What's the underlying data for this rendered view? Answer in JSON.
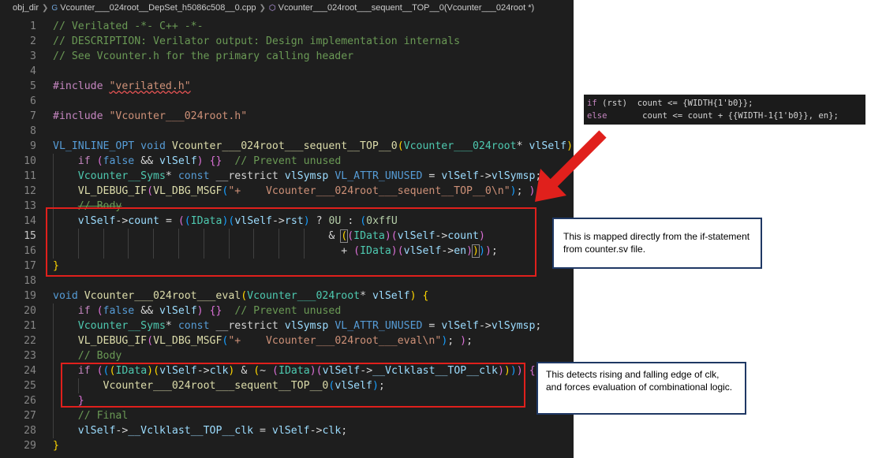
{
  "breadcrumb": {
    "folder": "obj_dir",
    "file": "Vcounter___024root__DepSet_h5086c508__0.cpp",
    "symbol": "Vcounter___024root___sequent__TOP__0(Vcounter___024root *)"
  },
  "colors": {
    "comment": "#6a9955",
    "keyword": "#569cd6",
    "string": "#ce9178",
    "function": "#dcdcaa",
    "type": "#4ec9b0",
    "variable": "#9cdcfe",
    "number": "#b5cea8",
    "highlight_box": "#e0201c",
    "callout_border": "#1f3864"
  },
  "active_line": 15,
  "lines": [
    {
      "n": "1",
      "tokens": [
        {
          "t": "// Verilated -*- C++ -*-",
          "c": "cm"
        }
      ]
    },
    {
      "n": "2",
      "tokens": [
        {
          "t": "// DESCRIPTION: Verilator output: Design implementation internals",
          "c": "cm"
        }
      ]
    },
    {
      "n": "3",
      "tokens": [
        {
          "t": "// See Vcounter.h for the primary calling header",
          "c": "cm"
        }
      ]
    },
    {
      "n": "4",
      "tokens": []
    },
    {
      "n": "5",
      "tokens": [
        {
          "t": "#include ",
          "c": "pp"
        },
        {
          "t": "\"verilated.h\"",
          "c": "str squig"
        }
      ]
    },
    {
      "n": "6",
      "tokens": []
    },
    {
      "n": "7",
      "tokens": [
        {
          "t": "#include ",
          "c": "pp"
        },
        {
          "t": "\"Vcounter___024root.h\"",
          "c": "str"
        }
      ]
    },
    {
      "n": "8",
      "tokens": []
    },
    {
      "n": "9",
      "tokens": [
        {
          "t": "VL_INLINE_OPT ",
          "c": "mc"
        },
        {
          "t": "void ",
          "c": "kw"
        },
        {
          "t": "Vcounter___024root___sequent__TOP__0",
          "c": "fn"
        },
        {
          "t": "(",
          "c": "br1"
        },
        {
          "t": "Vcounter___024root",
          "c": "ty"
        },
        {
          "t": "* "
        },
        {
          "t": "vlSelf",
          "c": "var"
        },
        {
          "t": ")",
          "c": "br1"
        },
        {
          "t": " "
        },
        {
          "t": "{",
          "c": "br1"
        }
      ]
    },
    {
      "n": "10",
      "guides": [
        1
      ],
      "tokens": [
        {
          "t": "    "
        },
        {
          "t": "if ",
          "c": "pp"
        },
        {
          "t": "(",
          "c": "br2"
        },
        {
          "t": "false ",
          "c": "kw"
        },
        {
          "t": "&& "
        },
        {
          "t": "vlSelf",
          "c": "var"
        },
        {
          "t": ")",
          "c": "br2"
        },
        {
          "t": " "
        },
        {
          "t": "{}",
          "c": "br2"
        },
        {
          "t": "  "
        },
        {
          "t": "// Prevent unused",
          "c": "cm"
        }
      ]
    },
    {
      "n": "11",
      "guides": [
        1
      ],
      "tokens": [
        {
          "t": "    "
        },
        {
          "t": "Vcounter__Syms",
          "c": "ty"
        },
        {
          "t": "* "
        },
        {
          "t": "const ",
          "c": "kw"
        },
        {
          "t": "__restrict "
        },
        {
          "t": "vlSymsp ",
          "c": "var"
        },
        {
          "t": "VL_ATTR_UNUSED ",
          "c": "mc"
        },
        {
          "t": "= "
        },
        {
          "t": "vlSelf",
          "c": "var"
        },
        {
          "t": "->"
        },
        {
          "t": "vlSymsp",
          "c": "var"
        },
        {
          "t": ";"
        }
      ]
    },
    {
      "n": "12",
      "guides": [
        1
      ],
      "tokens": [
        {
          "t": "    "
        },
        {
          "t": "VL_DEBUG_IF",
          "c": "fn"
        },
        {
          "t": "(",
          "c": "br2"
        },
        {
          "t": "VL_DBG_MSGF",
          "c": "fn"
        },
        {
          "t": "(",
          "c": "br3"
        },
        {
          "t": "\"+    Vcounter___024root___sequent__TOP__0\\n\"",
          "c": "str"
        },
        {
          "t": ")",
          "c": "br3"
        },
        {
          "t": "; "
        },
        {
          "t": ")",
          "c": "br2"
        },
        {
          "t": ";"
        }
      ]
    },
    {
      "n": "13",
      "guides": [
        1
      ],
      "tokens": [
        {
          "t": "    "
        },
        {
          "t": "// Body",
          "c": "cm strike"
        }
      ]
    },
    {
      "n": "14",
      "guides": [
        1
      ],
      "tokens": [
        {
          "t": "    "
        },
        {
          "t": "vlSelf",
          "c": "var"
        },
        {
          "t": "->"
        },
        {
          "t": "count",
          "c": "var"
        },
        {
          "t": " = "
        },
        {
          "t": "(",
          "c": "br2"
        },
        {
          "t": "(",
          "c": "br3"
        },
        {
          "t": "IData",
          "c": "ty"
        },
        {
          "t": ")",
          "c": "br3"
        },
        {
          "t": "(",
          "c": "br3"
        },
        {
          "t": "vlSelf",
          "c": "var"
        },
        {
          "t": "->"
        },
        {
          "t": "rst",
          "c": "var"
        },
        {
          "t": ")",
          "c": "br3"
        },
        {
          "t": " ? "
        },
        {
          "t": "0U",
          "c": "num"
        },
        {
          "t": " : "
        },
        {
          "t": "(",
          "c": "br3"
        },
        {
          "t": "0xffU",
          "c": "num"
        }
      ]
    },
    {
      "n": "15",
      "guides": [
        1,
        2,
        3,
        4,
        5,
        6,
        7,
        8,
        9,
        10,
        11,
        12,
        13,
        14,
        15,
        16,
        17,
        18,
        19,
        20,
        21,
        22,
        23,
        24,
        25,
        26,
        27,
        28,
        29,
        30,
        31,
        32,
        33,
        34,
        35,
        36,
        37,
        38,
        39,
        40,
        41,
        42,
        43,
        44,
        45,
        46,
        47,
        48,
        49,
        50,
        51,
        52,
        53,
        54,
        55,
        56,
        57,
        58,
        59,
        60,
        61,
        62,
        63,
        64,
        65,
        66,
        67,
        68,
        69,
        70,
        71,
        72,
        73,
        74,
        75,
        76,
        77,
        78,
        79,
        80,
        81,
        82,
        83,
        84,
        85,
        86,
        87,
        88,
        89,
        90,
        91,
        92,
        93,
        94,
        95,
        96,
        97,
        98,
        99,
        100
      ],
      "tokens": [
        {
          "t": "                                            & "
        },
        {
          "t": "(",
          "c": "br1 matchbox"
        },
        {
          "t": "(",
          "c": "br2"
        },
        {
          "t": "IData",
          "c": "ty"
        },
        {
          "t": ")",
          "c": "br2"
        },
        {
          "t": "(",
          "c": "br2"
        },
        {
          "t": "vlSelf",
          "c": "var"
        },
        {
          "t": "->"
        },
        {
          "t": "count",
          "c": "var"
        },
        {
          "t": ")",
          "c": "br2"
        }
      ]
    },
    {
      "n": "16",
      "tokens": [
        {
          "t": "                                              + "
        },
        {
          "t": "(",
          "c": "br2"
        },
        {
          "t": "IData",
          "c": "ty"
        },
        {
          "t": ")",
          "c": "br2"
        },
        {
          "t": "(",
          "c": "br2"
        },
        {
          "t": "vlSelf",
          "c": "var"
        },
        {
          "t": "->"
        },
        {
          "t": "en",
          "c": "var"
        },
        {
          "t": ")",
          "c": "br2"
        },
        {
          "t": ")",
          "c": "br1 matchbox"
        },
        {
          "t": ")",
          "c": "br3"
        },
        {
          "t": ")",
          "c": "br2"
        },
        {
          "t": ";"
        }
      ]
    },
    {
      "n": "17",
      "tokens": [
        {
          "t": "}",
          "c": "br1"
        }
      ]
    },
    {
      "n": "18",
      "tokens": []
    },
    {
      "n": "19",
      "tokens": [
        {
          "t": "void ",
          "c": "kw"
        },
        {
          "t": "Vcounter___024root___eval",
          "c": "fn"
        },
        {
          "t": "(",
          "c": "br1"
        },
        {
          "t": "Vcounter___024root",
          "c": "ty"
        },
        {
          "t": "* "
        },
        {
          "t": "vlSelf",
          "c": "var"
        },
        {
          "t": ")",
          "c": "br1"
        },
        {
          "t": " "
        },
        {
          "t": "{",
          "c": "br1"
        }
      ]
    },
    {
      "n": "20",
      "guides": [
        1
      ],
      "tokens": [
        {
          "t": "    "
        },
        {
          "t": "if ",
          "c": "pp"
        },
        {
          "t": "(",
          "c": "br2"
        },
        {
          "t": "false ",
          "c": "kw"
        },
        {
          "t": "&& "
        },
        {
          "t": "vlSelf",
          "c": "var"
        },
        {
          "t": ")",
          "c": "br2"
        },
        {
          "t": " "
        },
        {
          "t": "{}",
          "c": "br2"
        },
        {
          "t": "  "
        },
        {
          "t": "// Prevent unused",
          "c": "cm"
        }
      ]
    },
    {
      "n": "21",
      "guides": [
        1
      ],
      "tokens": [
        {
          "t": "    "
        },
        {
          "t": "Vcounter__Syms",
          "c": "ty"
        },
        {
          "t": "* "
        },
        {
          "t": "const ",
          "c": "kw"
        },
        {
          "t": "__restrict "
        },
        {
          "t": "vlSymsp ",
          "c": "var"
        },
        {
          "t": "VL_ATTR_UNUSED ",
          "c": "mc"
        },
        {
          "t": "= "
        },
        {
          "t": "vlSelf",
          "c": "var"
        },
        {
          "t": "->"
        },
        {
          "t": "vlSymsp",
          "c": "var"
        },
        {
          "t": ";"
        }
      ]
    },
    {
      "n": "22",
      "guides": [
        1
      ],
      "tokens": [
        {
          "t": "    "
        },
        {
          "t": "VL_DEBUG_IF",
          "c": "fn"
        },
        {
          "t": "(",
          "c": "br2"
        },
        {
          "t": "VL_DBG_MSGF",
          "c": "fn"
        },
        {
          "t": "(",
          "c": "br3"
        },
        {
          "t": "\"+    Vcounter___024root___eval\\n\"",
          "c": "str"
        },
        {
          "t": ")",
          "c": "br3"
        },
        {
          "t": "; "
        },
        {
          "t": ")",
          "c": "br2"
        },
        {
          "t": ";"
        }
      ]
    },
    {
      "n": "23",
      "guides": [
        1
      ],
      "tokens": [
        {
          "t": "    "
        },
        {
          "t": "// Body",
          "c": "cm"
        }
      ]
    },
    {
      "n": "24",
      "guides": [
        1
      ],
      "tokens": [
        {
          "t": "    "
        },
        {
          "t": "if ",
          "c": "pp"
        },
        {
          "t": "(",
          "c": "br2"
        },
        {
          "t": "(",
          "c": "br3"
        },
        {
          "t": "(",
          "c": "br1"
        },
        {
          "t": "IData",
          "c": "ty"
        },
        {
          "t": ")",
          "c": "br1"
        },
        {
          "t": "(",
          "c": "br1"
        },
        {
          "t": "vlSelf",
          "c": "var"
        },
        {
          "t": "->"
        },
        {
          "t": "clk",
          "c": "var"
        },
        {
          "t": ")",
          "c": "br1"
        },
        {
          "t": " & "
        },
        {
          "t": "(",
          "c": "br1"
        },
        {
          "t": "~ "
        },
        {
          "t": "(",
          "c": "br2"
        },
        {
          "t": "IData",
          "c": "ty"
        },
        {
          "t": ")",
          "c": "br2"
        },
        {
          "t": "(",
          "c": "br2"
        },
        {
          "t": "vlSelf",
          "c": "var"
        },
        {
          "t": "->"
        },
        {
          "t": "__Vclklast__TOP__clk",
          "c": "var"
        },
        {
          "t": ")",
          "c": "br2"
        },
        {
          "t": ")",
          "c": "br1"
        },
        {
          "t": ")",
          "c": "br3"
        },
        {
          "t": ")",
          "c": "br2"
        },
        {
          "t": " "
        },
        {
          "t": "{",
          "c": "br2"
        }
      ]
    },
    {
      "n": "25",
      "guides": [
        1,
        2
      ],
      "tokens": [
        {
          "t": "        "
        },
        {
          "t": "Vcounter___024root___sequent__TOP__0",
          "c": "fn"
        },
        {
          "t": "(",
          "c": "br3"
        },
        {
          "t": "vlSelf",
          "c": "var"
        },
        {
          "t": ")",
          "c": "br3"
        },
        {
          "t": ";"
        }
      ]
    },
    {
      "n": "26",
      "guides": [
        1
      ],
      "tokens": [
        {
          "t": "    "
        },
        {
          "t": "}",
          "c": "br2"
        }
      ]
    },
    {
      "n": "27",
      "guides": [
        1
      ],
      "tokens": [
        {
          "t": "    "
        },
        {
          "t": "// Final",
          "c": "cm"
        }
      ]
    },
    {
      "n": "28",
      "guides": [
        1
      ],
      "tokens": [
        {
          "t": "    "
        },
        {
          "t": "vlSelf",
          "c": "var"
        },
        {
          "t": "->"
        },
        {
          "t": "__Vclklast__TOP__clk",
          "c": "var"
        },
        {
          "t": " = "
        },
        {
          "t": "vlSelf",
          "c": "var"
        },
        {
          "t": "->"
        },
        {
          "t": "clk",
          "c": "var"
        },
        {
          "t": ";"
        }
      ]
    },
    {
      "n": "29",
      "tokens": [
        {
          "t": "}",
          "c": "br1"
        }
      ]
    }
  ],
  "snippet": [
    [
      {
        "t": "if ",
        "c": "kw"
      },
      {
        "t": "(rst)  count <= {WIDTH{1'b0}};"
      }
    ],
    [
      {
        "t": "else",
        "c": "kw"
      },
      {
        "t": "       count <= count + {{WIDTH-1{1'b0}}, en};"
      }
    ]
  ],
  "callout1": "This is mapped directly from the if-statement from counter.sv file.",
  "callout2": "This detects rising and falling edge of clk, and forces evaluation of combinational logic."
}
